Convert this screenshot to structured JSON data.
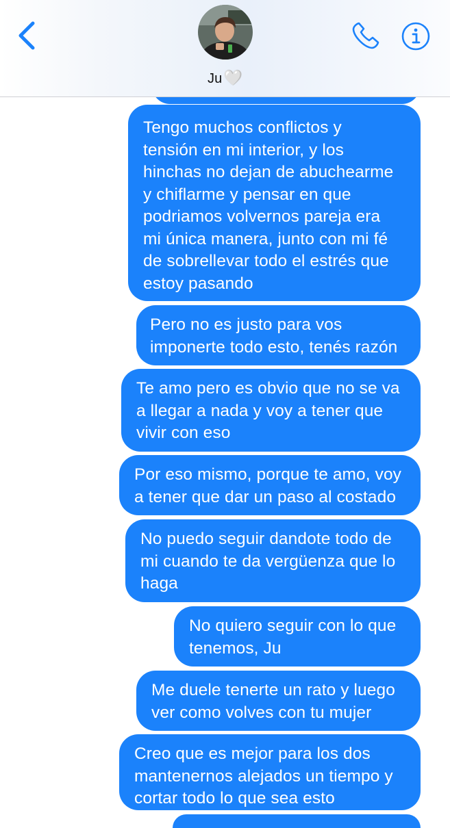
{
  "header": {
    "contact_name": "Ju",
    "name_emoji": "🤍",
    "back_icon": "chevron-left-icon",
    "call_icon": "phone-icon",
    "info_icon": "info-icon"
  },
  "colors": {
    "accent": "#1b82fb",
    "bubble_text": "#ffffff",
    "header_bg": "#eef3fa"
  },
  "messages": [
    {
      "lines": [
        "Tengo muchos conflictos y",
        "tensión en mi interior, y los",
        "hinchas no dejan de abuchearme",
        "y chiflarme y pensar en que",
        "podriamos volvernos pareja era",
        "mi única manera, junto con mi fé",
        "de sobrellevar todo el estrés que",
        "estoy pasando"
      ]
    },
    {
      "lines": [
        "Pero no es justo para vos",
        "imponerte todo esto, tenés razón"
      ]
    },
    {
      "lines": [
        "Te amo pero es obvio que no se va",
        "a llegar a nada y voy a tener que",
        "vivir con eso"
      ]
    },
    {
      "lines": [
        "Por eso mismo, porque te amo, voy",
        "a tener que dar un paso al costado"
      ]
    },
    {
      "lines": [
        "No puedo seguir dandote todo de",
        "mi cuando te da vergüenza que lo",
        "haga"
      ]
    },
    {
      "lines": [
        "No quiero seguir con lo que",
        "tenemos, Ju"
      ]
    },
    {
      "lines": [
        "Me duele tenerte un rato y luego",
        "ver como volves con tu mujer"
      ]
    },
    {
      "lines": [
        "Creo que es mejor para los dos",
        "mantenernos alejados un tiempo y",
        "cortar todo lo que sea esto"
      ]
    }
  ]
}
